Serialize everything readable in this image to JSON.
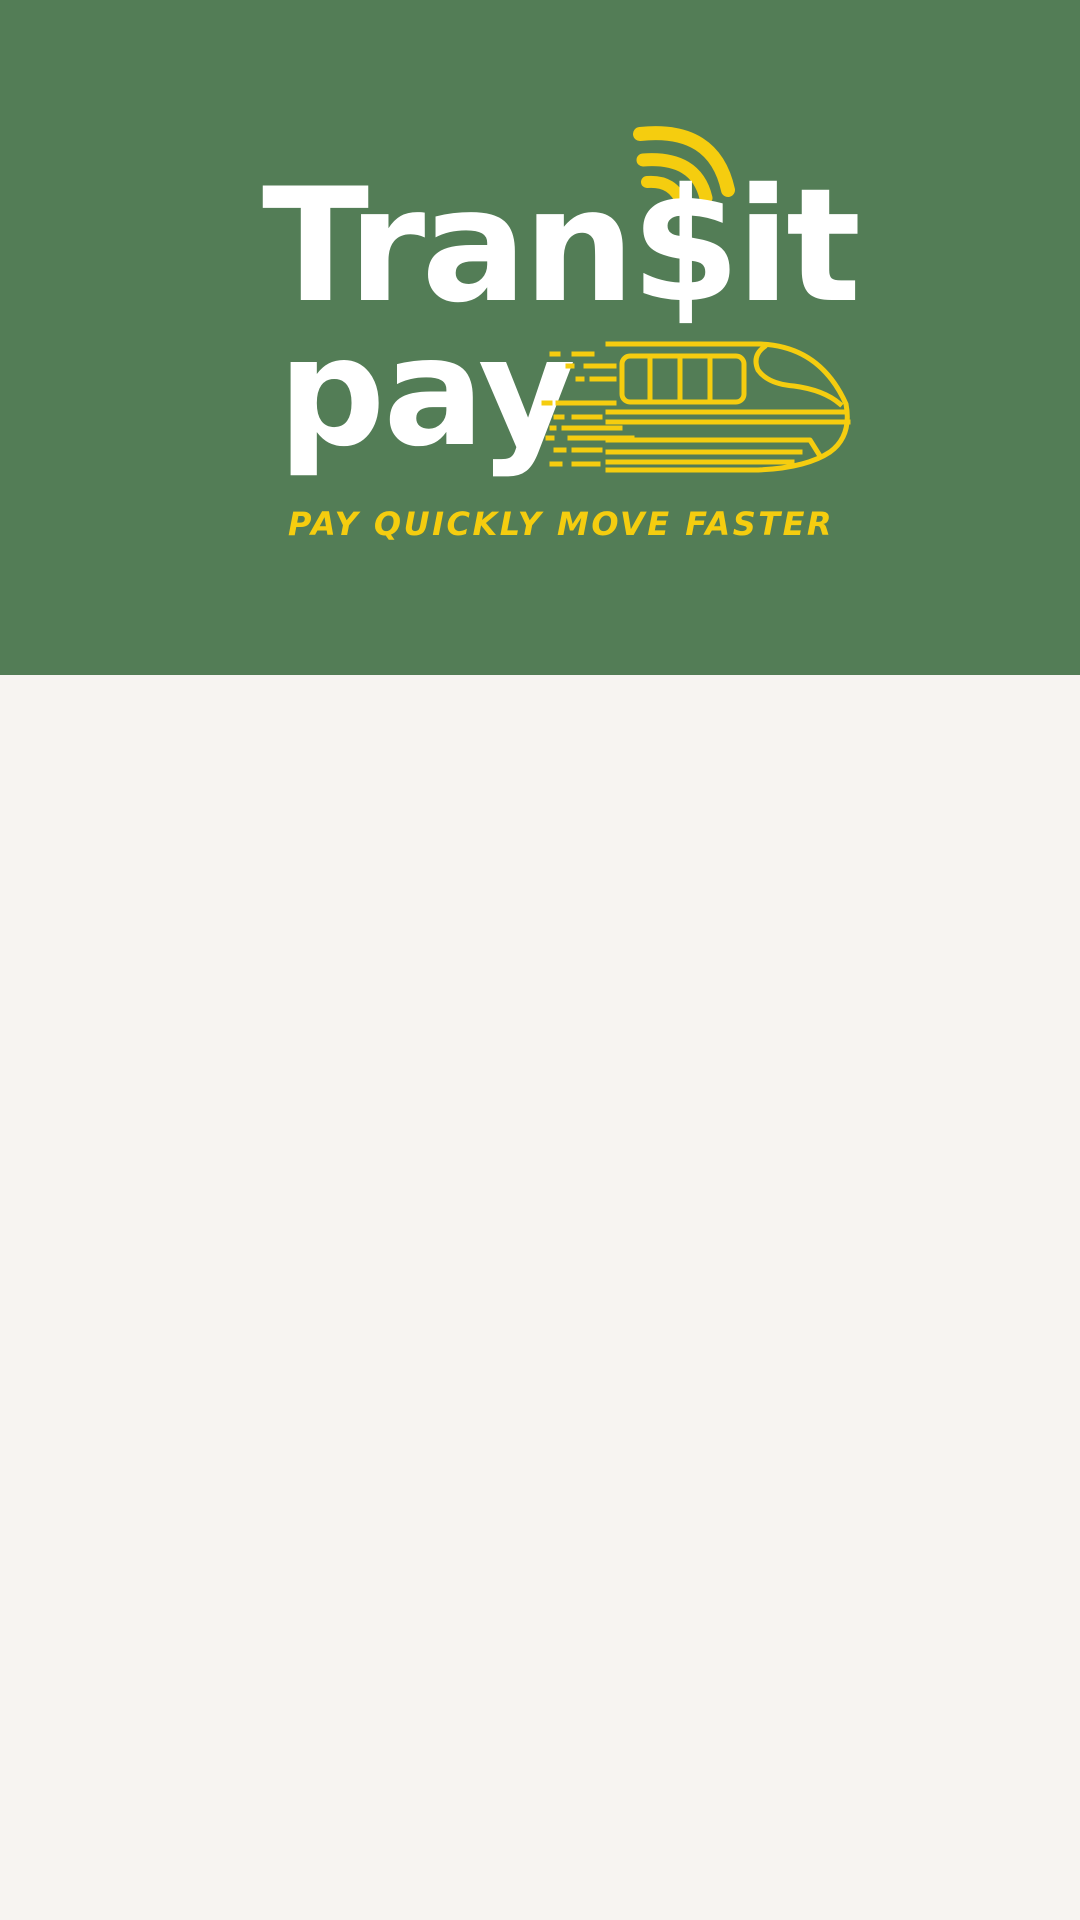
{
  "brand": {
    "name_line1": "Tran$it",
    "name_line2": "pay",
    "tagline": "PAY QUICKLY MOVE FASTER"
  },
  "icons": {
    "contactless": "contactless-wifi-icon",
    "train": "train-icon"
  },
  "colors": {
    "hero_background": "#537d56",
    "accent": "#f5cd0f",
    "logo_text": "#ffffff",
    "page_background": "#f7f4f1"
  }
}
